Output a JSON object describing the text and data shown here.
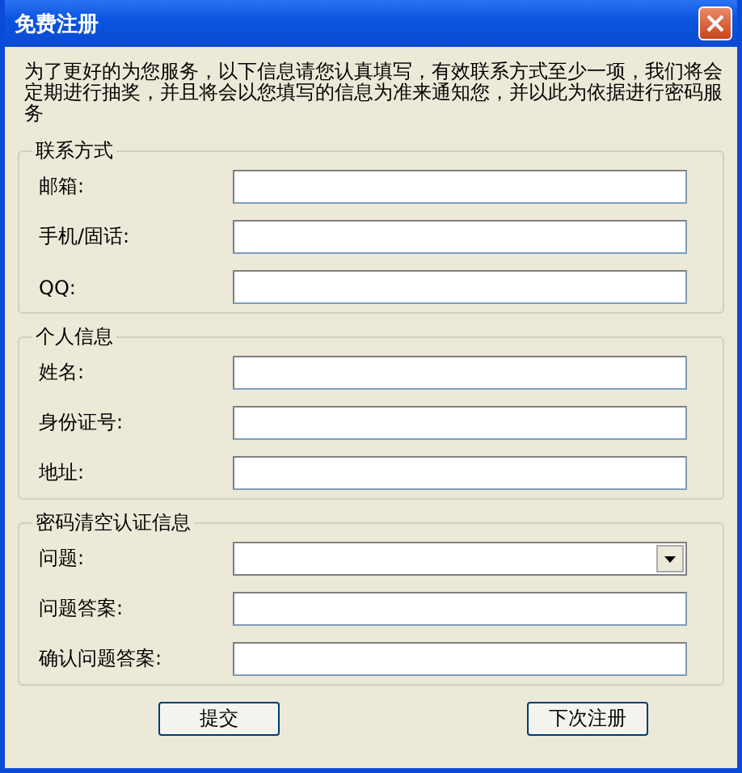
{
  "window": {
    "title": "免费注册"
  },
  "intro": "为了更好的为您服务，以下信息请您认真填写，有效联系方式至少一项，我们将会定期进行抽奖，并且将会以您填写的信息为准来通知您，并以此为依据进行密码服务",
  "groups": [
    {
      "title": "联系方式",
      "fields": [
        {
          "label": "邮箱:",
          "kind": "text"
        },
        {
          "label": "手机/固话:",
          "kind": "text"
        },
        {
          "label": "QQ:",
          "kind": "text"
        }
      ]
    },
    {
      "title": "个人信息",
      "fields": [
        {
          "label": "姓名:",
          "kind": "text"
        },
        {
          "label": "身份证号:",
          "kind": "text"
        },
        {
          "label": "地址:",
          "kind": "text"
        }
      ]
    },
    {
      "title": "密码清空认证信息",
      "fields": [
        {
          "label": "问题:",
          "kind": "select"
        },
        {
          "label": "问题答案:",
          "kind": "text"
        },
        {
          "label": "确认问题答案:",
          "kind": "text"
        }
      ]
    }
  ],
  "buttons": [
    "提交",
    "下次注册"
  ]
}
